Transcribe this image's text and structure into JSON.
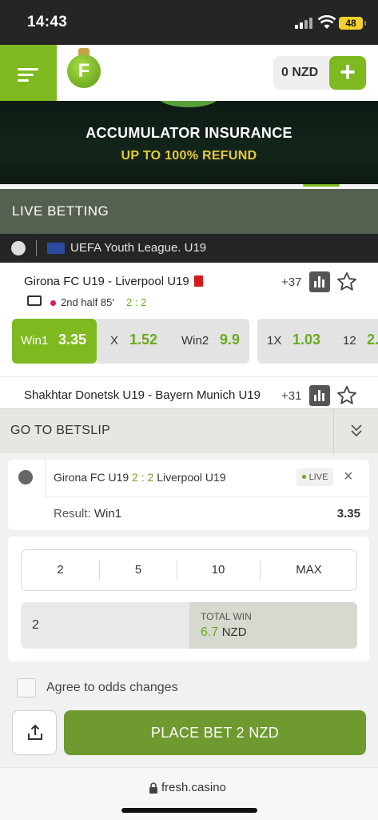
{
  "status": {
    "time": "14:43",
    "battery": "48"
  },
  "header": {
    "logo_letter": "F",
    "balance": "0 NZD",
    "deposit_label": "+"
  },
  "banner": {
    "line1": "ACCUMULATOR INSURANCE",
    "line2": "UP TO 100% REFUND"
  },
  "live": {
    "heading": "LIVE BETTING",
    "league": "UEFA Youth League. U19",
    "match1": {
      "title": "Girona FC U19 - Liverpool U19",
      "markets_count": "+37",
      "period": "2nd half  85'",
      "score": "2 : 2",
      "odds": [
        {
          "label": "Win1",
          "value": "3.35",
          "selected": true
        },
        {
          "label": "X",
          "value": "1.52"
        },
        {
          "label": "Win2",
          "value": "9.9"
        },
        {
          "label": "1X",
          "value": "1.03"
        },
        {
          "label": "12",
          "value": "2."
        }
      ]
    },
    "match2": {
      "title": "Shakhtar Donetsk U19 - Bayern Munich U19",
      "markets_count": "+31"
    }
  },
  "betslip": {
    "heading": "GO TO BETSLIP",
    "selection": {
      "team1": "Girona FC U19",
      "score": "2 : 2",
      "team2": "Liverpool U19",
      "live_badge": "LIVE",
      "result_label": "Result:",
      "result_value": "Win1",
      "odd": "3.35"
    },
    "presets": [
      "2",
      "5",
      "10",
      "MAX"
    ],
    "stake": "2",
    "total_win_label": "TOTAL WIN",
    "total_win_value": "6.7",
    "currency": "NZD",
    "agree_label": "Agree to odds changes",
    "place_bet_label": "PLACE BET 2 NZD"
  },
  "browser": {
    "url": "fresh.casino"
  },
  "colors": {
    "accent": "#7db91f",
    "live_header": "#566050",
    "dark": "#262525"
  }
}
